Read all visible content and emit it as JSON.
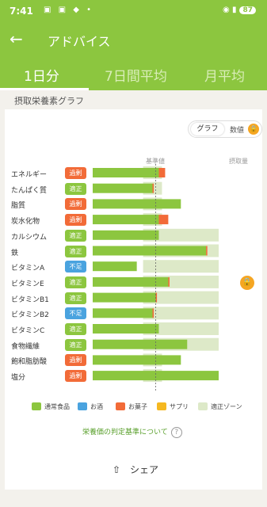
{
  "status": {
    "time": "7:41",
    "battery": "87"
  },
  "appbar": {
    "title": "アドバイス"
  },
  "tabs": [
    "1日分",
    "7日間平均",
    "月平均"
  ],
  "section_title": "摂取栄養素グラフ",
  "toggle": {
    "graph": "グラフ",
    "value": "数値"
  },
  "header": {
    "reference": "基準値",
    "intake": "摂取量"
  },
  "colors": {
    "food": "#8cc63f",
    "alcohol": "#4aa3df",
    "snack": "#f26b38",
    "supplement": "#f5b820",
    "zone": "#dde9c8",
    "excess": "#f26b38",
    "appropriate": "#8cc63f",
    "deficient": "#4aa3df"
  },
  "chart_data": {
    "type": "bar",
    "categories": [
      "エネルギー",
      "たんぱく質",
      "脂質",
      "炭水化物",
      "カルシウム",
      "鉄",
      "ビタミンA",
      "ビタミンE",
      "ビタミンB1",
      "ビタミンB2",
      "ビタミンC",
      "食物繊維",
      "飽和脂肪酸",
      "塩分"
    ],
    "status": [
      "過剰",
      "適正",
      "過剰",
      "過剰",
      "適正",
      "適正",
      "不足",
      "適正",
      "適正",
      "不足",
      "適正",
      "適正",
      "過剰",
      "過剰"
    ],
    "series": [
      {
        "name": "通常食品",
        "values": [
          1.05,
          0.95,
          1.4,
          1.05,
          1.05,
          1.8,
          0.7,
          1.2,
          1.0,
          0.95,
          1.05,
          1.5,
          1.4,
          2.0
        ]
      },
      {
        "name": "お酒",
        "values": [
          0,
          0,
          0,
          0,
          0,
          0,
          0,
          0,
          0,
          0,
          0,
          0,
          0,
          0
        ]
      },
      {
        "name": "お菓子",
        "values": [
          0.1,
          0.02,
          0,
          0.15,
          0,
          0.02,
          0,
          0.02,
          0.02,
          0.02,
          0,
          0,
          0,
          0
        ]
      },
      {
        "name": "サプリ",
        "values": [
          0,
          0,
          0,
          0,
          0,
          0,
          0,
          0,
          0,
          0,
          0,
          0,
          0,
          0
        ]
      }
    ],
    "zone": [
      [
        0.8,
        1.1
      ],
      [
        0.8,
        1.1
      ],
      [
        0.8,
        1.1
      ],
      [
        0.8,
        1.1
      ],
      [
        0.8,
        2.0
      ],
      [
        0.8,
        2.0
      ],
      [
        0.8,
        2.0
      ],
      [
        0.8,
        2.0
      ],
      [
        0.8,
        2.0
      ],
      [
        0.8,
        2.0
      ],
      [
        0.8,
        2.0
      ],
      [
        0.8,
        2.0
      ],
      [
        0.8,
        1.1
      ],
      [
        0.8,
        1.1
      ]
    ],
    "reference": 1.0,
    "xlim": [
      0,
      2.0
    ]
  },
  "legend": [
    {
      "label": "通常食品",
      "key": "food"
    },
    {
      "label": "お酒",
      "key": "alcohol"
    },
    {
      "label": "お菓子",
      "key": "snack"
    },
    {
      "label": "サプリ",
      "key": "supplement"
    },
    {
      "label": "適正ゾーン",
      "key": "zone"
    }
  ],
  "link": "栄養価の判定基準について",
  "share": "シェア"
}
